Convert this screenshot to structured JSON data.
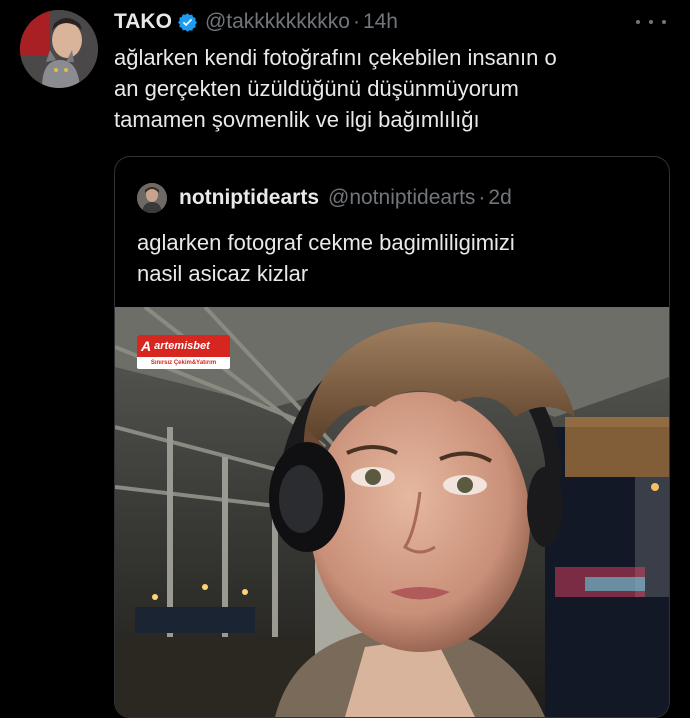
{
  "tweet": {
    "display_name": "TAKO",
    "handle": "@takkkkkkkkko",
    "separator": "·",
    "time": "14h",
    "lines": [
      "ağlarken kendi fotoğrafını çekebilen insanın o",
      "an gerçekten üzüldüğünü düşünmüyorum",
      "tamamen şovmenlik ve ilgi bağımlılığı"
    ]
  },
  "quote": {
    "display_name": "notniptidearts",
    "handle": "@notniptidearts",
    "separator": "·",
    "time": "2d",
    "lines": [
      "aglarken fotograf cekme bagimliligimizi",
      "nasil asicaz kizlar"
    ]
  },
  "photo_logo": {
    "mark": "A",
    "name": "artemisbet",
    "tagline": "Sınırsız Çekim&Yatırım"
  },
  "icons": {
    "verified": "verified-badge-icon",
    "more": "more-options-icon"
  },
  "colors": {
    "background": "#000000",
    "text": "#e7e9ea",
    "muted": "#71767b",
    "verified": "#1d9bf0",
    "border": "#2f3336",
    "logo_red": "#d6261f"
  }
}
